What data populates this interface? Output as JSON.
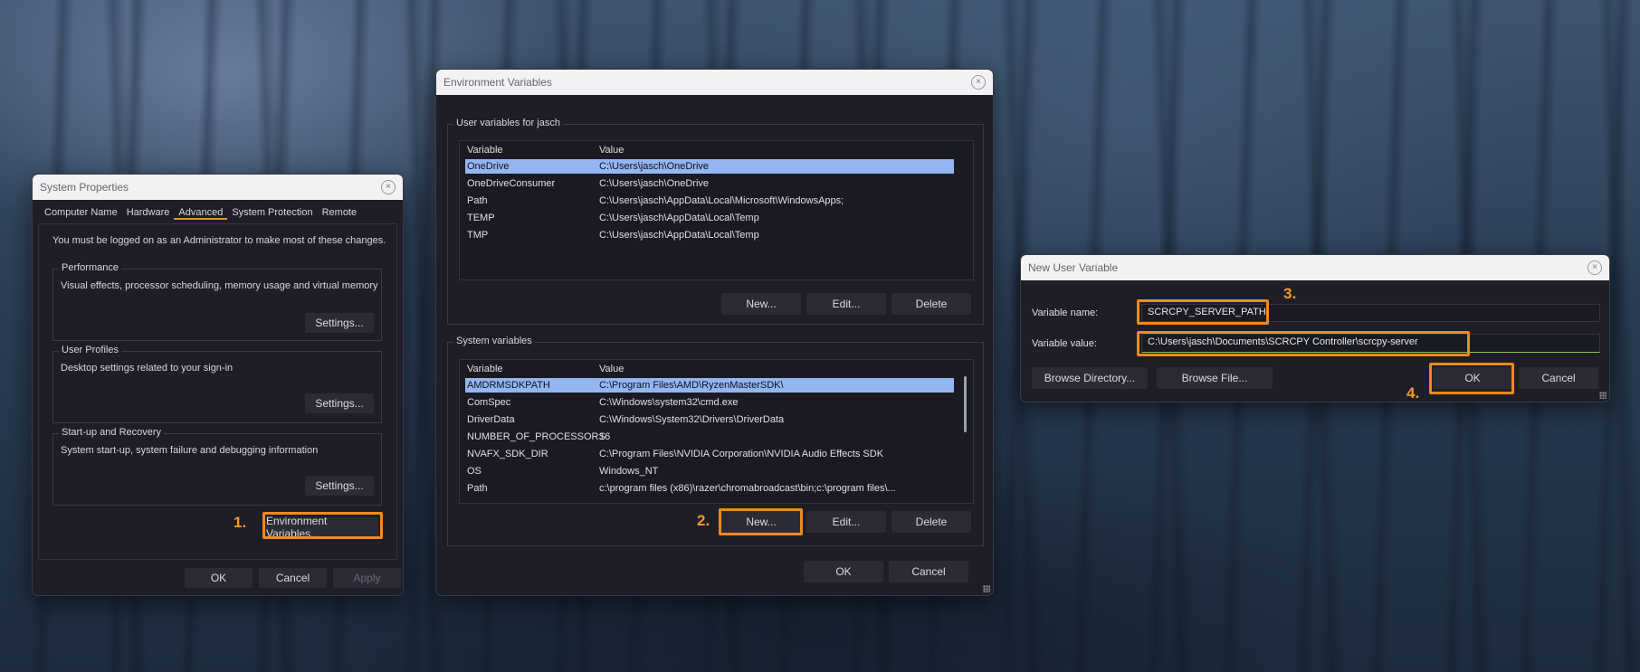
{
  "system_properties": {
    "title": "System Properties",
    "close_glyph": "×",
    "tabs": [
      {
        "label": "Computer Name"
      },
      {
        "label": "Hardware"
      },
      {
        "label": "Advanced"
      },
      {
        "label": "System Protection"
      },
      {
        "label": "Remote"
      }
    ],
    "admin_note": "You must be logged on as an Administrator to make most of these changes.",
    "performance": {
      "title": "Performance",
      "desc": "Visual effects, processor scheduling, memory usage and virtual memory",
      "button": "Settings..."
    },
    "user_profiles": {
      "title": "User Profiles",
      "desc": "Desktop settings related to your sign-in",
      "button": "Settings..."
    },
    "startup": {
      "title": "Start-up and Recovery",
      "desc": "System start-up, system failure and debugging information",
      "button": "Settings..."
    },
    "env_button": "Environment Variables...",
    "ok": "OK",
    "cancel": "Cancel",
    "apply": "Apply"
  },
  "env_vars": {
    "title": "Environment Variables",
    "close_glyph": "×",
    "user_group_title": "User variables for jasch",
    "columns": {
      "variable": "Variable",
      "value": "Value"
    },
    "user_rows": [
      {
        "name": "OneDrive",
        "value": "C:\\Users\\jasch\\OneDrive"
      },
      {
        "name": "OneDriveConsumer",
        "value": "C:\\Users\\jasch\\OneDrive"
      },
      {
        "name": "Path",
        "value": "C:\\Users\\jasch\\AppData\\Local\\Microsoft\\WindowsApps;"
      },
      {
        "name": "TEMP",
        "value": "C:\\Users\\jasch\\AppData\\Local\\Temp"
      },
      {
        "name": "TMP",
        "value": "C:\\Users\\jasch\\AppData\\Local\\Temp"
      }
    ],
    "user_new": "New...",
    "user_edit": "Edit...",
    "user_delete": "Delete",
    "system_group_title": "System variables",
    "system_rows": [
      {
        "name": "AMDRMSDKPATH",
        "value": "C:\\Program Files\\AMD\\RyzenMasterSDK\\"
      },
      {
        "name": "ComSpec",
        "value": "C:\\Windows\\system32\\cmd.exe"
      },
      {
        "name": "DriverData",
        "value": "C:\\Windows\\System32\\Drivers\\DriverData"
      },
      {
        "name": "NUMBER_OF_PROCESSORS",
        "value": "16"
      },
      {
        "name": "NVAFX_SDK_DIR",
        "value": "C:\\Program Files\\NVIDIA Corporation\\NVIDIA Audio Effects SDK"
      },
      {
        "name": "OS",
        "value": "Windows_NT"
      },
      {
        "name": "Path",
        "value": "c:\\program files (x86)\\razer\\chromabroadcast\\bin;c:\\program files\\..."
      }
    ],
    "system_new": "New...",
    "system_edit": "Edit...",
    "system_delete": "Delete",
    "ok": "OK",
    "cancel": "Cancel"
  },
  "new_user_var": {
    "title": "New User Variable",
    "close_glyph": "×",
    "name_label": "Variable name:",
    "name_value": "SCRCPY_SERVER_PATH",
    "value_label": "Variable value:",
    "value_value": "C:\\Users\\jasch\\Documents\\SCRCPY Controller\\scrcpy-server",
    "browse_dir": "Browse Directory...",
    "browse_file": "Browse File...",
    "ok": "OK",
    "cancel": "Cancel"
  },
  "steps": [
    "1.",
    "2.",
    "3.",
    "4."
  ],
  "colors": {
    "highlight": "#f28a1c",
    "selection": "#93b5f2",
    "accent_tab": "#e88b3a"
  }
}
